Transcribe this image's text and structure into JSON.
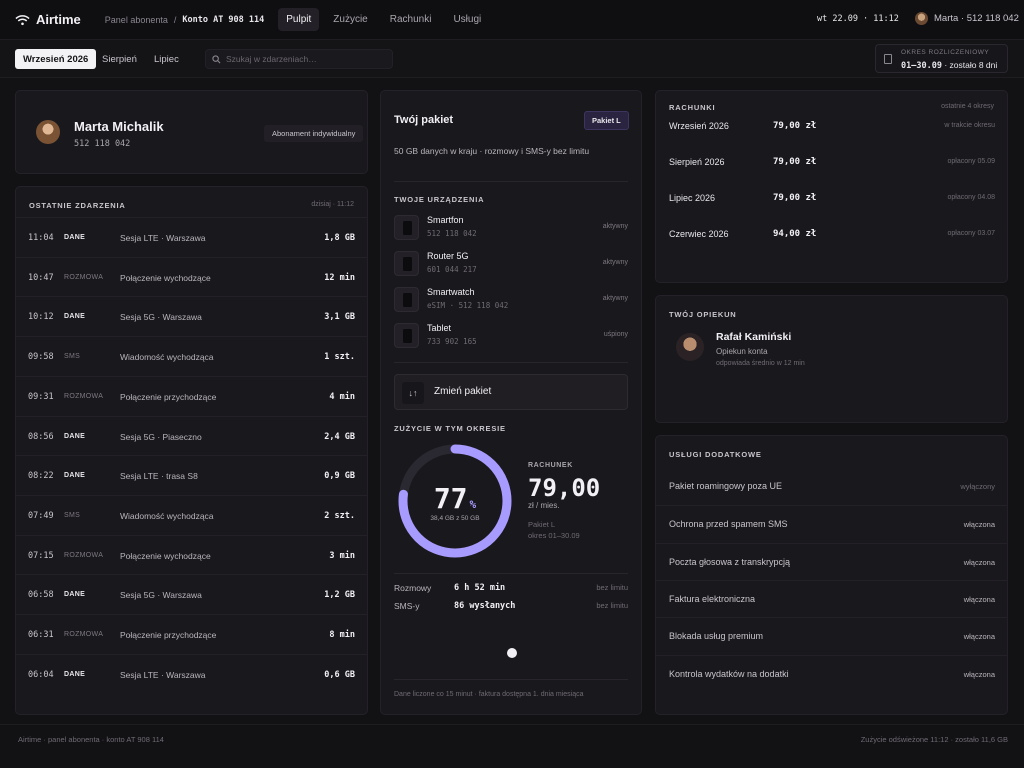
{
  "header": {
    "brand": "Airtime",
    "crumb_panel": "Panel abonenta",
    "crumb_sep": "/",
    "crumb_account": "Konto AT 908 114",
    "tabs": [
      {
        "label": "Pulpit",
        "active": true
      },
      {
        "label": "Zużycie",
        "active": false
      },
      {
        "label": "Rachunki",
        "active": false
      },
      {
        "label": "Usługi",
        "active": false
      }
    ],
    "clock": "wt 22.09 · 11:12",
    "user": "Marta · 512 118 042"
  },
  "subbar": {
    "months": [
      "Wrzesień 2026",
      "Sierpień",
      "Lipiec"
    ],
    "search_placeholder": "Szukaj w zdarzeniach…",
    "period_label": "OKRES ROZLICZENIOWY",
    "period_range": "01–30.09",
    "period_left": "· zostało 8 dni"
  },
  "profile": {
    "name": "Marta Michalik",
    "number": "512 118 042",
    "plan_type": "Abonament indywidualny"
  },
  "events": {
    "title": "OSTATNIE ZDARZENIA",
    "updated": "dzisiaj · 11:12",
    "rows": [
      {
        "time": "11:04",
        "type": "DANE",
        "desc": "Sesja LTE · Warszawa",
        "value": "1,8 GB"
      },
      {
        "time": "10:47",
        "type": "ROZMOWA",
        "desc": "Połączenie wychodzące",
        "value": "12 min"
      },
      {
        "time": "10:12",
        "type": "DANE",
        "desc": "Sesja 5G · Warszawa",
        "value": "3,1 GB"
      },
      {
        "time": "09:58",
        "type": "SMS",
        "desc": "Wiadomość wychodząca",
        "value": "1 szt."
      },
      {
        "time": "09:31",
        "type": "ROZMOWA",
        "desc": "Połączenie przychodzące",
        "value": "4 min"
      },
      {
        "time": "08:56",
        "type": "DANE",
        "desc": "Sesja 5G · Piaseczno",
        "value": "2,4 GB"
      },
      {
        "time": "08:22",
        "type": "DANE",
        "desc": "Sesja LTE · trasa S8",
        "value": "0,9 GB"
      },
      {
        "time": "07:49",
        "type": "SMS",
        "desc": "Wiadomość wychodząca",
        "value": "2 szt."
      },
      {
        "time": "07:15",
        "type": "ROZMOWA",
        "desc": "Połączenie wychodzące",
        "value": "3 min"
      },
      {
        "time": "06:58",
        "type": "DANE",
        "desc": "Sesja 5G · Warszawa",
        "value": "1,2 GB"
      },
      {
        "time": "06:31",
        "type": "ROZMOWA",
        "desc": "Połączenie przychodzące",
        "value": "8 min"
      },
      {
        "time": "06:04",
        "type": "DANE",
        "desc": "Sesja LTE · Warszawa",
        "value": "0,6 GB"
      }
    ]
  },
  "package": {
    "title": "Twój pakiet",
    "badge": "Pakiet L",
    "desc": "50 GB danych w kraju · rozmowy i SMS-y bez limitu",
    "devices_title": "TWOJE URZĄDZENIA",
    "devices": [
      {
        "name": "Smartfon",
        "meta": "512 118 042",
        "status": "aktywny"
      },
      {
        "name": "Router 5G",
        "meta": "601 044 217",
        "status": "aktywny"
      },
      {
        "name": "Smartwatch",
        "meta": "eSIM · 512 118 042",
        "status": "aktywny"
      },
      {
        "name": "Tablet",
        "meta": "733 902 165",
        "status": "uśpiony"
      }
    ],
    "change_label": "Zmień pakiet",
    "change_icon": "↓↑",
    "usage_title": "ZUŻYCIE W TYM OKRESIE",
    "usage_pct": "77",
    "usage_pct_sign": "%",
    "usage_fraction": 0.77,
    "usage_sub": "38,4 GB z 50 GB",
    "bill_label": "RACHUNEK",
    "bill_value": "79,00",
    "bill_unit": "zł / mies.",
    "bill_plan": "Pakiet L",
    "bill_period": "okres 01–30.09",
    "limits": [
      {
        "name": "Rozmowy",
        "value": "6 h 52 min",
        "note": "bez limitu"
      },
      {
        "name": "SMS-y",
        "value": "86 wysłanych",
        "note": "bez limitu"
      }
    ],
    "footer": "Dane liczone co 15 minut · faktura dostępna 1. dnia miesiąca"
  },
  "bills": {
    "title": "RACHUNKI",
    "range": "ostatnie 4 okresy",
    "rows": [
      {
        "month": "Wrzesień 2026",
        "amount": "79,00 zł",
        "status": "w trakcie okresu"
      },
      {
        "month": "Sierpień 2026",
        "amount": "79,00 zł",
        "status": "opłacony 05.09"
      },
      {
        "month": "Lipiec 2026",
        "amount": "79,00 zł",
        "status": "opłacony 04.08"
      },
      {
        "month": "Czerwiec 2026",
        "amount": "94,00 zł",
        "status": "opłacony 03.07"
      }
    ]
  },
  "caretaker": {
    "title": "TWÓJ OPIEKUN",
    "name": "Rafał Kamiński",
    "role": "Opiekun konta",
    "response": "odpowiada średnio w 12 min"
  },
  "services": {
    "title": "USŁUGI DODATKOWE",
    "rows": [
      {
        "name": "Pakiet roamingowy poza UE",
        "status": "wyłączony",
        "on": false
      },
      {
        "name": "Ochrona przed spamem SMS",
        "status": "włączona",
        "on": true
      },
      {
        "name": "Poczta głosowa z transkrypcją",
        "status": "włączona",
        "on": true
      },
      {
        "name": "Faktura elektroniczna",
        "status": "włączona",
        "on": true
      },
      {
        "name": "Blokada usług premium",
        "status": "włączona",
        "on": true
      },
      {
        "name": "Kontrola wydatków na dodatki",
        "status": "włączona",
        "on": true
      }
    ]
  },
  "footer": {
    "left": "Airtime · panel abonenta · konto AT 908 114",
    "right": "Zużycie odświeżone 11:12 · zostało 11,6 GB"
  },
  "colors": {
    "accent": "#a89bff",
    "track": "#2a2830"
  }
}
